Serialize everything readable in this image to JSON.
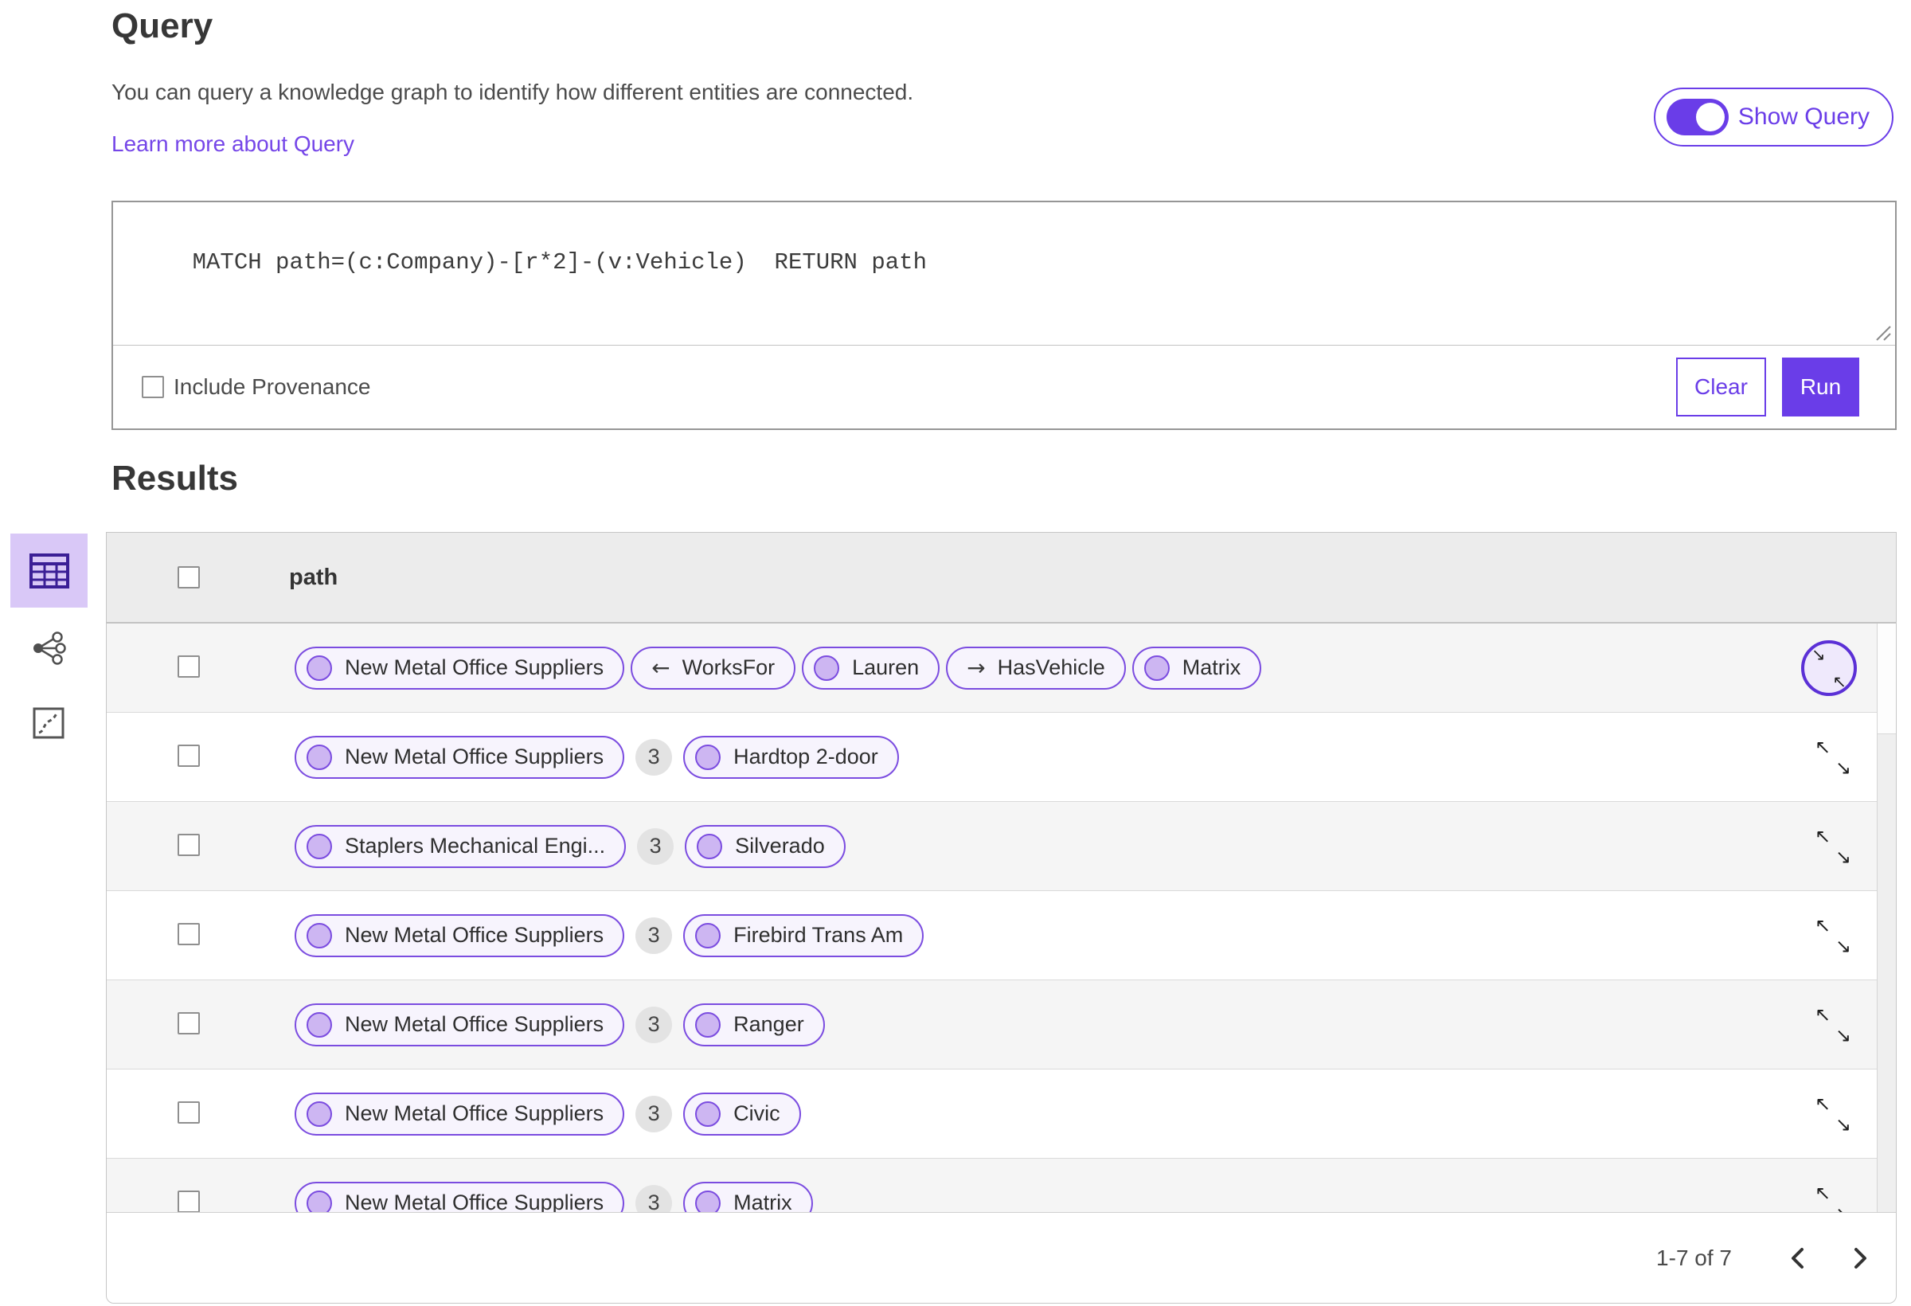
{
  "query": {
    "title": "Query",
    "description": "You can query a knowledge graph to identify how different entities are connected.",
    "learn_more": "Learn more about Query",
    "show_query": "Show Query",
    "show_query_on": true,
    "text": "MATCH path=(c:Company)-[r*2]-(v:Vehicle)  RETURN path",
    "include_provenance": "Include Provenance",
    "include_provenance_checked": false,
    "clear": "Clear",
    "run": "Run"
  },
  "view_switcher": {
    "tabs": [
      {
        "name": "table",
        "selected": true
      },
      {
        "name": "link-chart",
        "selected": false
      },
      {
        "name": "map",
        "selected": false
      }
    ]
  },
  "results": {
    "title": "Results",
    "path_header": "path",
    "rows": [
      {
        "expand": "focused",
        "segments": [
          {
            "type": "entity",
            "label": "New Metal Office Suppliers"
          },
          {
            "type": "relationship",
            "direction": "left",
            "label": "WorksFor"
          },
          {
            "type": "entity",
            "label": "Lauren"
          },
          {
            "type": "relationship",
            "direction": "right",
            "label": "HasVehicle"
          },
          {
            "type": "entity",
            "label": "Matrix"
          }
        ]
      },
      {
        "expand": "normal",
        "segments": [
          {
            "type": "entity",
            "label": "New Metal Office Suppliers"
          },
          {
            "type": "count",
            "label": "3"
          },
          {
            "type": "entity",
            "label": "Hardtop 2-door"
          }
        ]
      },
      {
        "expand": "normal",
        "segments": [
          {
            "type": "entity",
            "label": "Staplers Mechanical Engi..."
          },
          {
            "type": "count",
            "label": "3"
          },
          {
            "type": "entity",
            "label": "Silverado"
          }
        ]
      },
      {
        "expand": "normal",
        "segments": [
          {
            "type": "entity",
            "label": "New Metal Office Suppliers"
          },
          {
            "type": "count",
            "label": "3"
          },
          {
            "type": "entity",
            "label": "Firebird Trans Am"
          }
        ]
      },
      {
        "expand": "normal",
        "segments": [
          {
            "type": "entity",
            "label": "New Metal Office Suppliers"
          },
          {
            "type": "count",
            "label": "3"
          },
          {
            "type": "entity",
            "label": "Ranger"
          }
        ]
      },
      {
        "expand": "normal",
        "segments": [
          {
            "type": "entity",
            "label": "New Metal Office Suppliers"
          },
          {
            "type": "count",
            "label": "3"
          },
          {
            "type": "entity",
            "label": "Civic"
          }
        ]
      },
      {
        "expand": "normal",
        "segments": [
          {
            "type": "entity",
            "label": "New Metal Office Suppliers"
          },
          {
            "type": "count",
            "label": "3"
          },
          {
            "type": "entity",
            "label": "Matrix"
          }
        ]
      }
    ],
    "pagination": {
      "range_label": "1-7 of 7"
    }
  },
  "colors": {
    "accent": "#6a3de8",
    "accent_deep": "#5b30d6",
    "link": "#7546e8",
    "pill_border": "#7b4ce0",
    "pill_bg": "#f7f4fd",
    "node_fill": "#cdb6f2",
    "header_bg": "#ececec",
    "row_alt": "#f5f5f5",
    "badge_bg": "#e3e3e3",
    "selected_tab_bg": "#d9c8f7",
    "selected_tab_icon": "#3b1f96"
  }
}
